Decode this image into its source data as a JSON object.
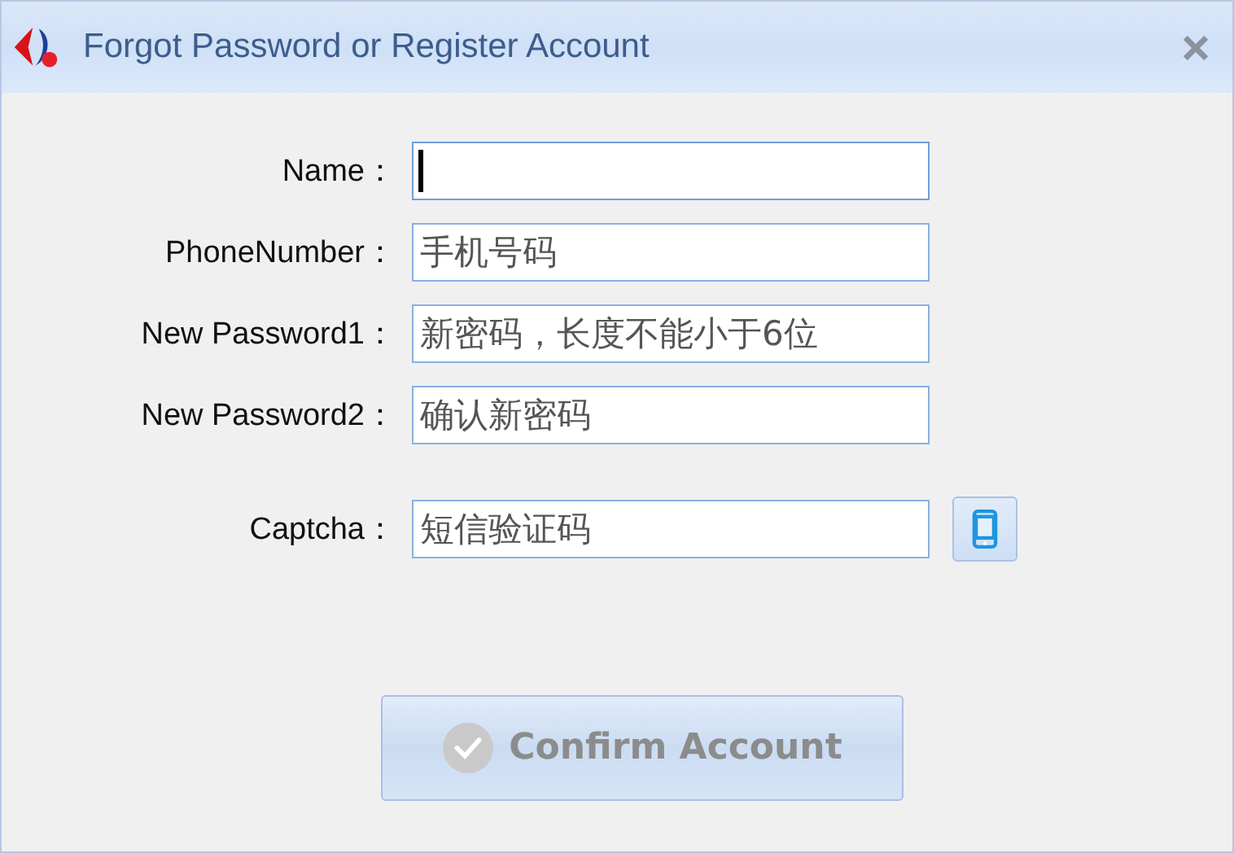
{
  "window": {
    "title": "Forgot Password or Register Account"
  },
  "fields": [
    {
      "label": "Name：",
      "focused": true
    },
    {
      "label": "PhoneNumber：",
      "placeholder": "手机号码",
      "focused": false
    },
    {
      "label": "New Password1：",
      "placeholder": "新密码，长度不能小于6位",
      "focused": false
    },
    {
      "label": "New Password2：",
      "placeholder": "确认新密码",
      "focused": false
    }
  ],
  "captcha": {
    "label": "Captcha：",
    "placeholder": "短信验证码",
    "focused": false
  },
  "confirm_button": {
    "label": "Confirm Account",
    "disabled": true
  }
}
